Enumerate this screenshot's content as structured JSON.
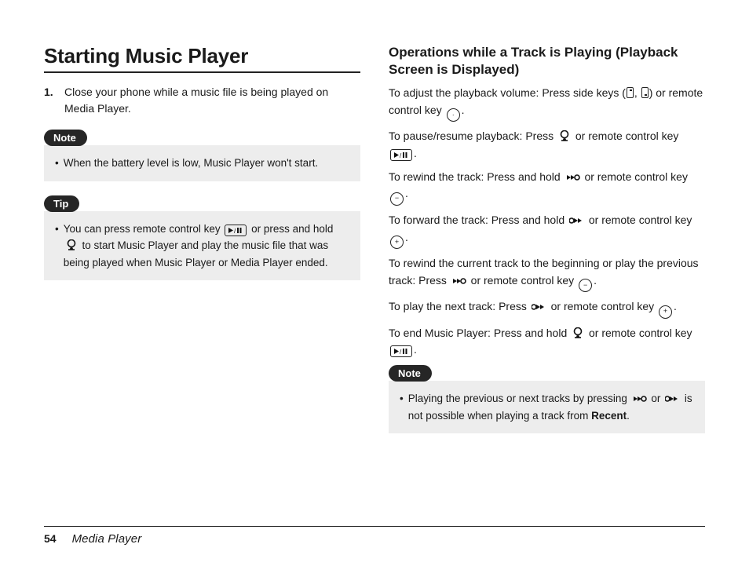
{
  "left": {
    "title": "Starting Music Player",
    "step1_num": "1.",
    "step1_text": "Close your phone while a music file is being played on Media Player.",
    "note_label": "Note",
    "note_text": "When the battery level is low, Music Player won't start.",
    "tip_label": "Tip",
    "tip_pre": "You can press remote control key ",
    "tip_mid": " or press and hold ",
    "tip_post": " to start Music Player and play the music file that was being played when Music Player or Media Player ended."
  },
  "right": {
    "title": "Operations while a Track is Playing (Playback Screen is Displayed)",
    "vol_pre": "To adjust the playback volume: Press side keys (",
    "vol_mid": ", ",
    "vol_post": ") or remote control key ",
    "vol_end": ".",
    "pause_pre": "To pause/resume playback: Press ",
    "pause_mid": " or remote control key ",
    "pause_end": ".",
    "rew_pre": "To rewind the track: Press and hold ",
    "rew_mid": " or remote control key ",
    "rew_end": ".",
    "fwd_pre": "To forward the track: Press and hold ",
    "fwd_mid": " or remote control key ",
    "fwd_end": ".",
    "prev_pre": "To rewind the current track to the beginning or play the previous track: Press ",
    "prev_mid": " or remote control key ",
    "prev_end": ".",
    "next_pre": "To play the next track: Press ",
    "next_mid": " or remote control key ",
    "next_end": ".",
    "end_pre": "To end Music Player: Press and hold ",
    "end_mid": " or remote control key ",
    "end_end": ".",
    "note_label": "Note",
    "note_pre": "Playing the previous or next tracks by pressing ",
    "note_mid": " or ",
    "note_post": " is not possible when playing a track from ",
    "note_bold": "Recent",
    "note_end": "."
  },
  "footer": {
    "page": "54",
    "section": "Media Player"
  }
}
